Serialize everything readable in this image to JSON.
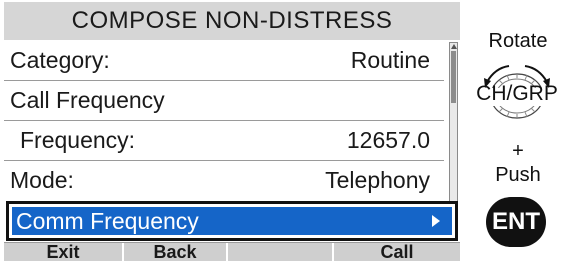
{
  "screen": {
    "title": "COMPOSE NON-DISTRESS",
    "rows": [
      {
        "label": "Category:",
        "value": "Routine"
      },
      {
        "label": "Call Frequency",
        "value": ""
      },
      {
        "label": "Frequency:",
        "value": "12657.0"
      },
      {
        "label": "Mode:",
        "value": "Telephony"
      }
    ],
    "selected_row": {
      "label": "Comm Frequency"
    },
    "softkeys": [
      "Exit",
      "Back",
      "",
      "Call"
    ]
  },
  "controls": {
    "rotate_label": "Rotate",
    "knob_label": "CH/GRP",
    "plus_label": "+",
    "push_label": "Push",
    "ent_label": "ENT"
  },
  "colors": {
    "title_bar": "#d6d6d6",
    "selection": "#1565c8",
    "softkey_bar": "#cfcfcf",
    "ent_button": "#111111"
  }
}
